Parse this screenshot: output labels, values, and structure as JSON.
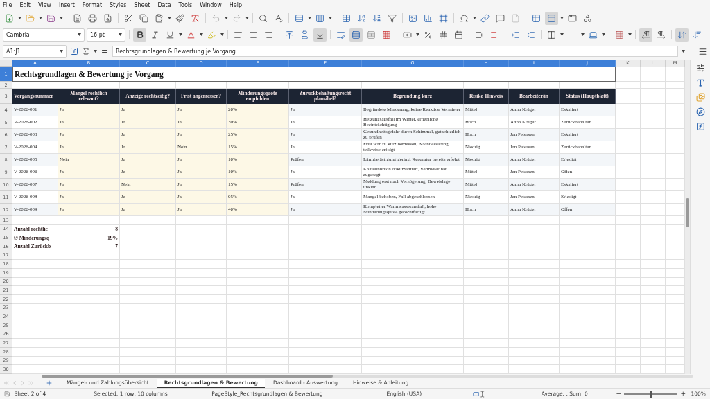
{
  "menu": [
    "File",
    "Edit",
    "View",
    "Insert",
    "Format",
    "Styles",
    "Sheet",
    "Data",
    "Tools",
    "Window",
    "Help"
  ],
  "font": {
    "name": "Cambria",
    "size": "16 pt"
  },
  "bold": true,
  "name_box": "A1:J1",
  "formula": "Rechtsgrundlagen & Bewertung je Vorgang",
  "columns": [
    {
      "label": "A",
      "selected": true
    },
    {
      "label": "B",
      "selected": true
    },
    {
      "label": "C",
      "selected": true
    },
    {
      "label": "D",
      "selected": true
    },
    {
      "label": "E",
      "selected": true
    },
    {
      "label": "F",
      "selected": true
    },
    {
      "label": "G",
      "selected": true
    },
    {
      "label": "H",
      "selected": true
    },
    {
      "label": "I",
      "selected": true
    },
    {
      "label": "J",
      "selected": true
    },
    {
      "label": "K",
      "selected": false
    },
    {
      "label": "L",
      "selected": false
    },
    {
      "label": "M",
      "selected": false
    }
  ],
  "row_headers": [
    {
      "label": "1",
      "selected": true
    },
    {
      "label": "2",
      "selected": false
    },
    {
      "label": "3",
      "selected": false
    },
    {
      "label": "4",
      "selected": false
    },
    {
      "label": "5",
      "selected": false
    },
    {
      "label": "6",
      "selected": false
    },
    {
      "label": "7",
      "selected": false
    },
    {
      "label": "8",
      "selected": false
    },
    {
      "label": "9",
      "selected": false
    },
    {
      "label": "10",
      "selected": false
    },
    {
      "label": "11",
      "selected": false
    },
    {
      "label": "12",
      "selected": false
    },
    {
      "label": "13",
      "selected": false
    },
    {
      "label": "14",
      "selected": false
    },
    {
      "label": "15",
      "selected": false
    },
    {
      "label": "16",
      "selected": false
    },
    {
      "label": "17",
      "selected": false
    },
    {
      "label": "18",
      "selected": false
    },
    {
      "label": "19",
      "selected": false
    },
    {
      "label": "20",
      "selected": false
    },
    {
      "label": "21",
      "selected": false
    },
    {
      "label": "22",
      "selected": false
    },
    {
      "label": "23",
      "selected": false
    },
    {
      "label": "24",
      "selected": false
    },
    {
      "label": "25",
      "selected": false
    },
    {
      "label": "26",
      "selected": false
    },
    {
      "label": "27",
      "selected": false
    },
    {
      "label": "28",
      "selected": false
    },
    {
      "label": "29",
      "selected": false
    },
    {
      "label": "30",
      "selected": false
    }
  ],
  "title": "Rechtsgrundlagen & Bewertung je Vorgang",
  "header": [
    "Vorgangsnummer",
    "Mangel rechtlich relevant?",
    "Anzeige rechtzeitig?",
    "Frist angemessen?",
    "Minderungsquote empfohlen",
    "Zurückbehaltungsrecht plausibel?",
    "Begründung kurz",
    "Risiko-Hinweis",
    "Bearbeiter/in",
    "Status (Hauptblatt)"
  ],
  "records": [
    [
      "V-2026-001",
      "Ja",
      "Ja",
      "Ja",
      "20%",
      "Ja",
      "Begründete Minderung, keine Reaktion Vermieter",
      "Mittel",
      "Anna Krüger",
      "Eskaliert"
    ],
    [
      "V-2026-002",
      "Ja",
      "Ja",
      "Ja",
      "30%",
      "Ja",
      "Heizungsausfall im Winter, erhebliche Beeinträchtigung",
      "Hoch",
      "Anna Krüger",
      "Zurückbehalten"
    ],
    [
      "V-2026-003",
      "Ja",
      "Ja",
      "Ja",
      "25%",
      "Ja",
      "Gesundheitsgefahr durch Schimmel, gutachterlich zu prüfen",
      "Hoch",
      "Jan Petersen",
      "Eskaliert"
    ],
    [
      "V-2026-004",
      "Ja",
      "Ja",
      "Nein",
      "15%",
      "Ja",
      "Frist war zu kurz bemessen, Nachbesserung teilweise erfolgt",
      "Niedrig",
      "Jan Petersen",
      "Zurückbehalten"
    ],
    [
      "V-2026-005",
      "Nein",
      "Ja",
      "Ja",
      "10%",
      "Prüfen",
      "Lärmbelästigung gering, Reparatur bereits erfolgt",
      "Niedrig",
      "Anna Krüger",
      "Erledigt"
    ],
    [
      "V-2026-006",
      "Ja",
      "Ja",
      "Ja",
      "10%",
      "Ja",
      "Kälteeinbruch dokumentiert, Vermieter hat zugesagt",
      "Mittel",
      "Jan Petersen",
      "Offen"
    ],
    [
      "V-2026-007",
      "Ja",
      "Nein",
      "Ja",
      "15%",
      "Prüfen",
      "Meldung erst nach Verzögerung, Beweislage unklar",
      "Mittel",
      "Anna Krüger",
      "Eskaliert"
    ],
    [
      "V-2026-008",
      "Ja",
      "Ja",
      "Ja",
      "05%",
      "Ja",
      "Mangel behoben, Fall abgeschlossen",
      "Niedrig",
      "Jan Petersen",
      "Erledigt"
    ],
    [
      "V-2026-009",
      "Ja",
      "Ja",
      "Ja",
      "40%",
      "Ja",
      "Kompletter Warmwasserausfall, hohe Minderungsquote gerechtfertigt",
      "Hoch",
      "Anna Krüger",
      "Offen"
    ]
  ],
  "summary": [
    {
      "label": "Anzahl rechtlic",
      "value": "8"
    },
    {
      "label": "Ø Minderungsq",
      "value": "19%"
    },
    {
      "label": "Anzahl Zurückb",
      "value": "7"
    }
  ],
  "sheet_tabs": [
    {
      "label": "Mängel- und Zahlungsübersicht",
      "selected": false
    },
    {
      "label": "Rechtsgrundlagen & Bewertung",
      "selected": true
    },
    {
      "label": "Dashboard - Auswertung",
      "selected": false
    },
    {
      "label": "Hinweise & Anleitung",
      "selected": false
    }
  ],
  "status": {
    "sheet": "Sheet 2 of 4",
    "selection": "Selected: 1 row, 10 columns",
    "page_style": "PageStyle_Rechtsgrundlagen & Bewertung",
    "language": "English (USA)",
    "sum": "Average: ; Sum: 0",
    "zoom": {
      "level": 0.5,
      "reading": "100%"
    }
  }
}
